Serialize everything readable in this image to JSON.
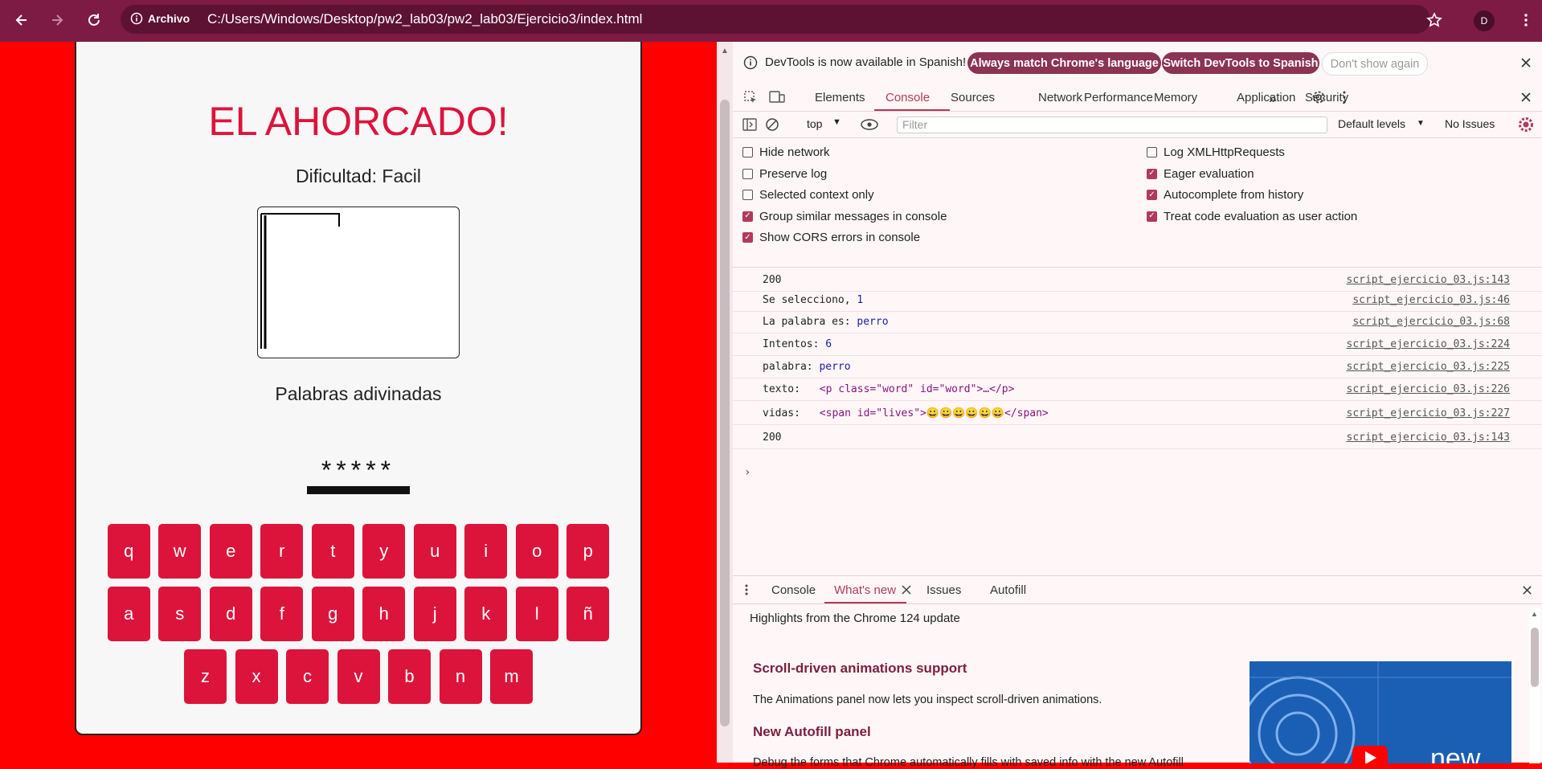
{
  "browser": {
    "chip_label": "Archivo",
    "url": "C:/Users/Windows/Desktop/pw2_lab03/pw2_lab03/Ejercicio3/index.html",
    "avatar_initial": "D"
  },
  "game": {
    "title": "EL AHORCADO!",
    "difficulty": "Dificultad: Facil",
    "words_title": "Palabras adivinadas",
    "word_display": "*****",
    "keyboard_rows": [
      [
        "q",
        "w",
        "e",
        "r",
        "t",
        "y",
        "u",
        "i",
        "o",
        "p"
      ],
      [
        "a",
        "s",
        "d",
        "f",
        "g",
        "h",
        "j",
        "k",
        "l",
        "ñ"
      ],
      [
        "z",
        "x",
        "c",
        "v",
        "b",
        "n",
        "m"
      ]
    ],
    "accent_color": "#dc143c",
    "background_color": "#ff0000"
  },
  "devtools": {
    "banner": {
      "text": "DevTools is now available in Spanish!",
      "match_button": "Always match Chrome's language",
      "switch_button": "Switch DevTools to Spanish",
      "dismiss_button": "Don't show again"
    },
    "tabs": [
      "Elements",
      "Console",
      "Sources",
      "Network",
      "Performance",
      "Memory",
      "Application",
      "Security"
    ],
    "more_tabs": "»",
    "active_tab": "Console",
    "toolbar": {
      "context": "top",
      "filter_placeholder": "Filter",
      "levels": "Default levels",
      "issues": "No Issues"
    },
    "settings_left": [
      {
        "label": "Hide network",
        "checked": false
      },
      {
        "label": "Preserve log",
        "checked": false
      },
      {
        "label": "Selected context only",
        "checked": false
      },
      {
        "label": "Group similar messages in console",
        "checked": true
      },
      {
        "label": "Show CORS errors in console",
        "checked": true
      }
    ],
    "settings_right": [
      {
        "label": "Log XMLHttpRequests",
        "checked": false
      },
      {
        "label": "Eager evaluation",
        "checked": true
      },
      {
        "label": "Autocomplete from history",
        "checked": true
      },
      {
        "label": "Treat code evaluation as user action",
        "checked": true
      }
    ],
    "messages": [
      {
        "text": "200",
        "source": "script_ejercicio_03.js:143"
      },
      {
        "label": "Se selecciono, ",
        "value": "1",
        "source": "script_ejercicio_03.js:46"
      },
      {
        "label": "La palabra es: ",
        "value": "perro",
        "source": "script_ejercicio_03.js:68"
      },
      {
        "label": "Intentos: ",
        "value": "6",
        "source": "script_ejercicio_03.js:224"
      },
      {
        "label": "palabra: ",
        "value": "perro",
        "source": "script_ejercicio_03.js:225"
      },
      {
        "label": "texto: ",
        "html": "<p class=\"word\" id=\"word\">…</p>",
        "source": "script_ejercicio_03.js:226"
      },
      {
        "label": "vidas: ",
        "html": "<span id=\"lives\">😀😀😀😀😀😀</span>",
        "source": "script_ejercicio_03.js:227"
      },
      {
        "text": "200",
        "source": "script_ejercicio_03.js:143"
      }
    ],
    "drawer": {
      "tabs": [
        "Console",
        "What's new",
        "Issues",
        "Autofill"
      ],
      "active_tab": "What's new",
      "highlights": "Highlights from the Chrome 124 update",
      "feature1_title": "Scroll-driven animations support",
      "feature1_desc": "The Animations panel now lets you inspect scroll-driven animations.",
      "feature2_title": "New Autofill panel",
      "feature2_desc": "Debug the forms that Chrome automatically fills with saved info with the new Autofill",
      "video_label": "new"
    }
  }
}
